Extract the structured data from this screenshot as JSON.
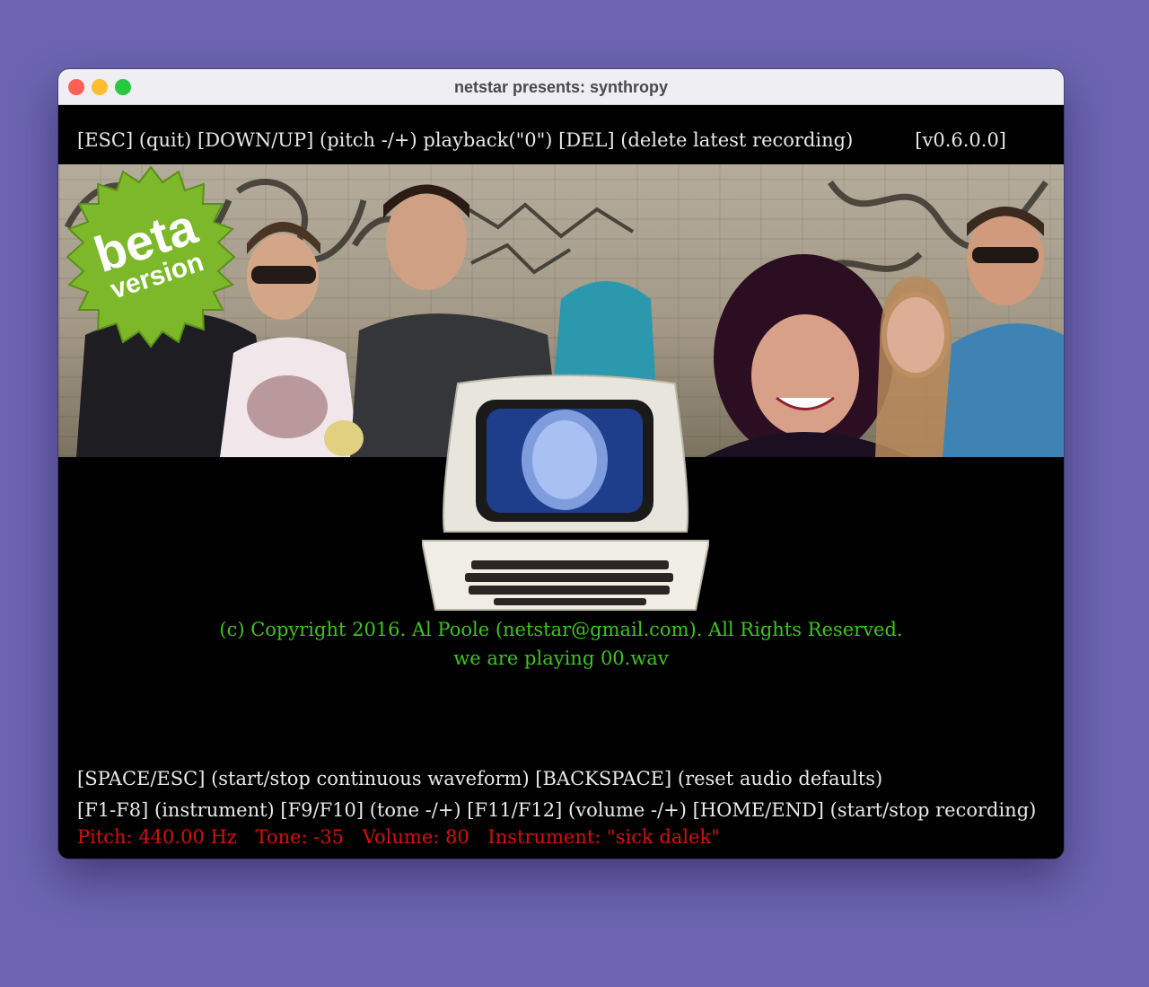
{
  "window": {
    "title": "netstar presents: synthropy"
  },
  "topbar": {
    "keys": "[ESC] (quit) [DOWN/UP] (pitch -/+) playback(\"0\") [DEL] (delete latest recording)",
    "version": "[v0.6.0.0]"
  },
  "badge": {
    "line1": "beta",
    "line2": "version"
  },
  "copyright": {
    "line1": "(c) Copyright 2016. Al Poole (netstar@gmail.com). All Rights Reserved.",
    "line2": "we are playing 00.wav"
  },
  "help": {
    "line1": "[SPACE/ESC] (start/stop continuous waveform) [BACKSPACE] (reset audio defaults)",
    "line2": "[F1-F8] (instrument) [F9/F10] (tone -/+) [F11/F12] (volume -/+) [HOME/END] (start/stop recording)"
  },
  "status": {
    "pitch": "Pitch: 440.00 Hz",
    "tone": "Tone: -35",
    "volume": "Volume: 80",
    "instrument": "Instrument: \"sick dalek\""
  },
  "colors": {
    "background": "#6c64b0",
    "text": "#e8e8e8",
    "copyright": "#3ec420",
    "status": "#d8100c",
    "badge": "#7cb82a"
  }
}
